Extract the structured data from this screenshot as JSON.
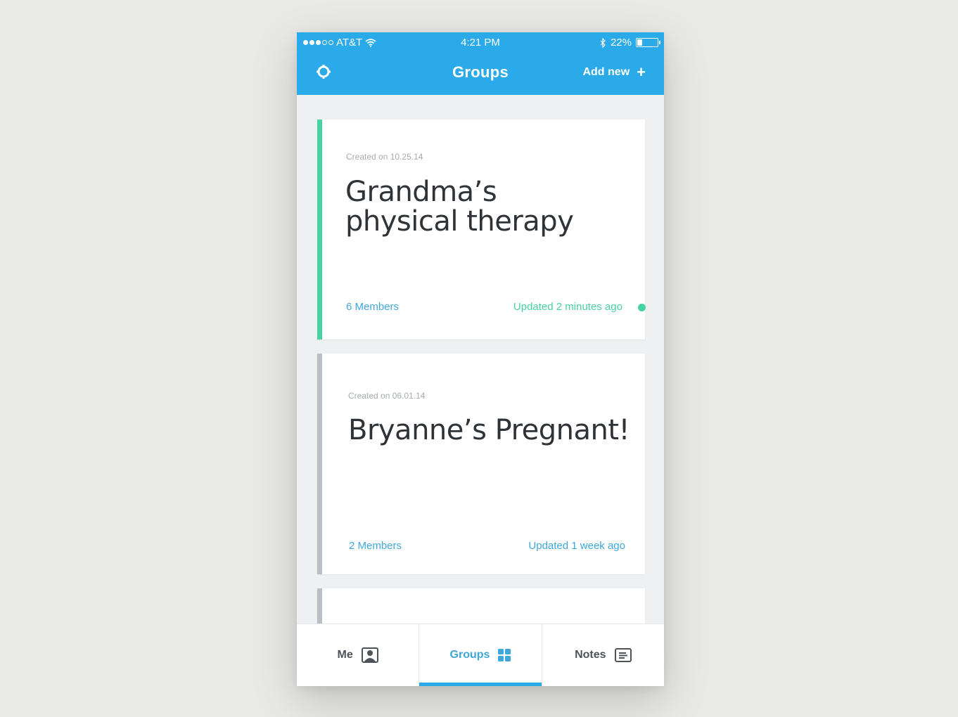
{
  "status_bar": {
    "carrier": "AT&T",
    "time": "4:21 PM",
    "battery": "22%",
    "battery_level": 0.22
  },
  "header": {
    "title": "Groups",
    "add_new_label": "Add new",
    "settings_icon": "gear-icon",
    "add_icon": "plus-icon",
    "color": "#2aaae9"
  },
  "groups": [
    {
      "created": "Created on 10.25.14",
      "title_line1": "Grandma’s",
      "title_line2": "physical therapy",
      "members": "6 Members",
      "updated": "Updated 2 minutes ago",
      "accent": "#47d2a1",
      "has_new": true
    },
    {
      "created": "Created on 06.01.14",
      "title_line1": "Bryanne’s Pregnant!",
      "members": "2 Members",
      "updated": "Updated 1 week ago",
      "accent": "#b8bfc6",
      "has_new": false
    }
  ],
  "tabs": [
    {
      "label": "Me",
      "icon": "person-icon",
      "active": false
    },
    {
      "label": "Groups",
      "icon": "grid-icon",
      "active": true
    },
    {
      "label": "Notes",
      "icon": "notes-icon",
      "active": false
    }
  ]
}
